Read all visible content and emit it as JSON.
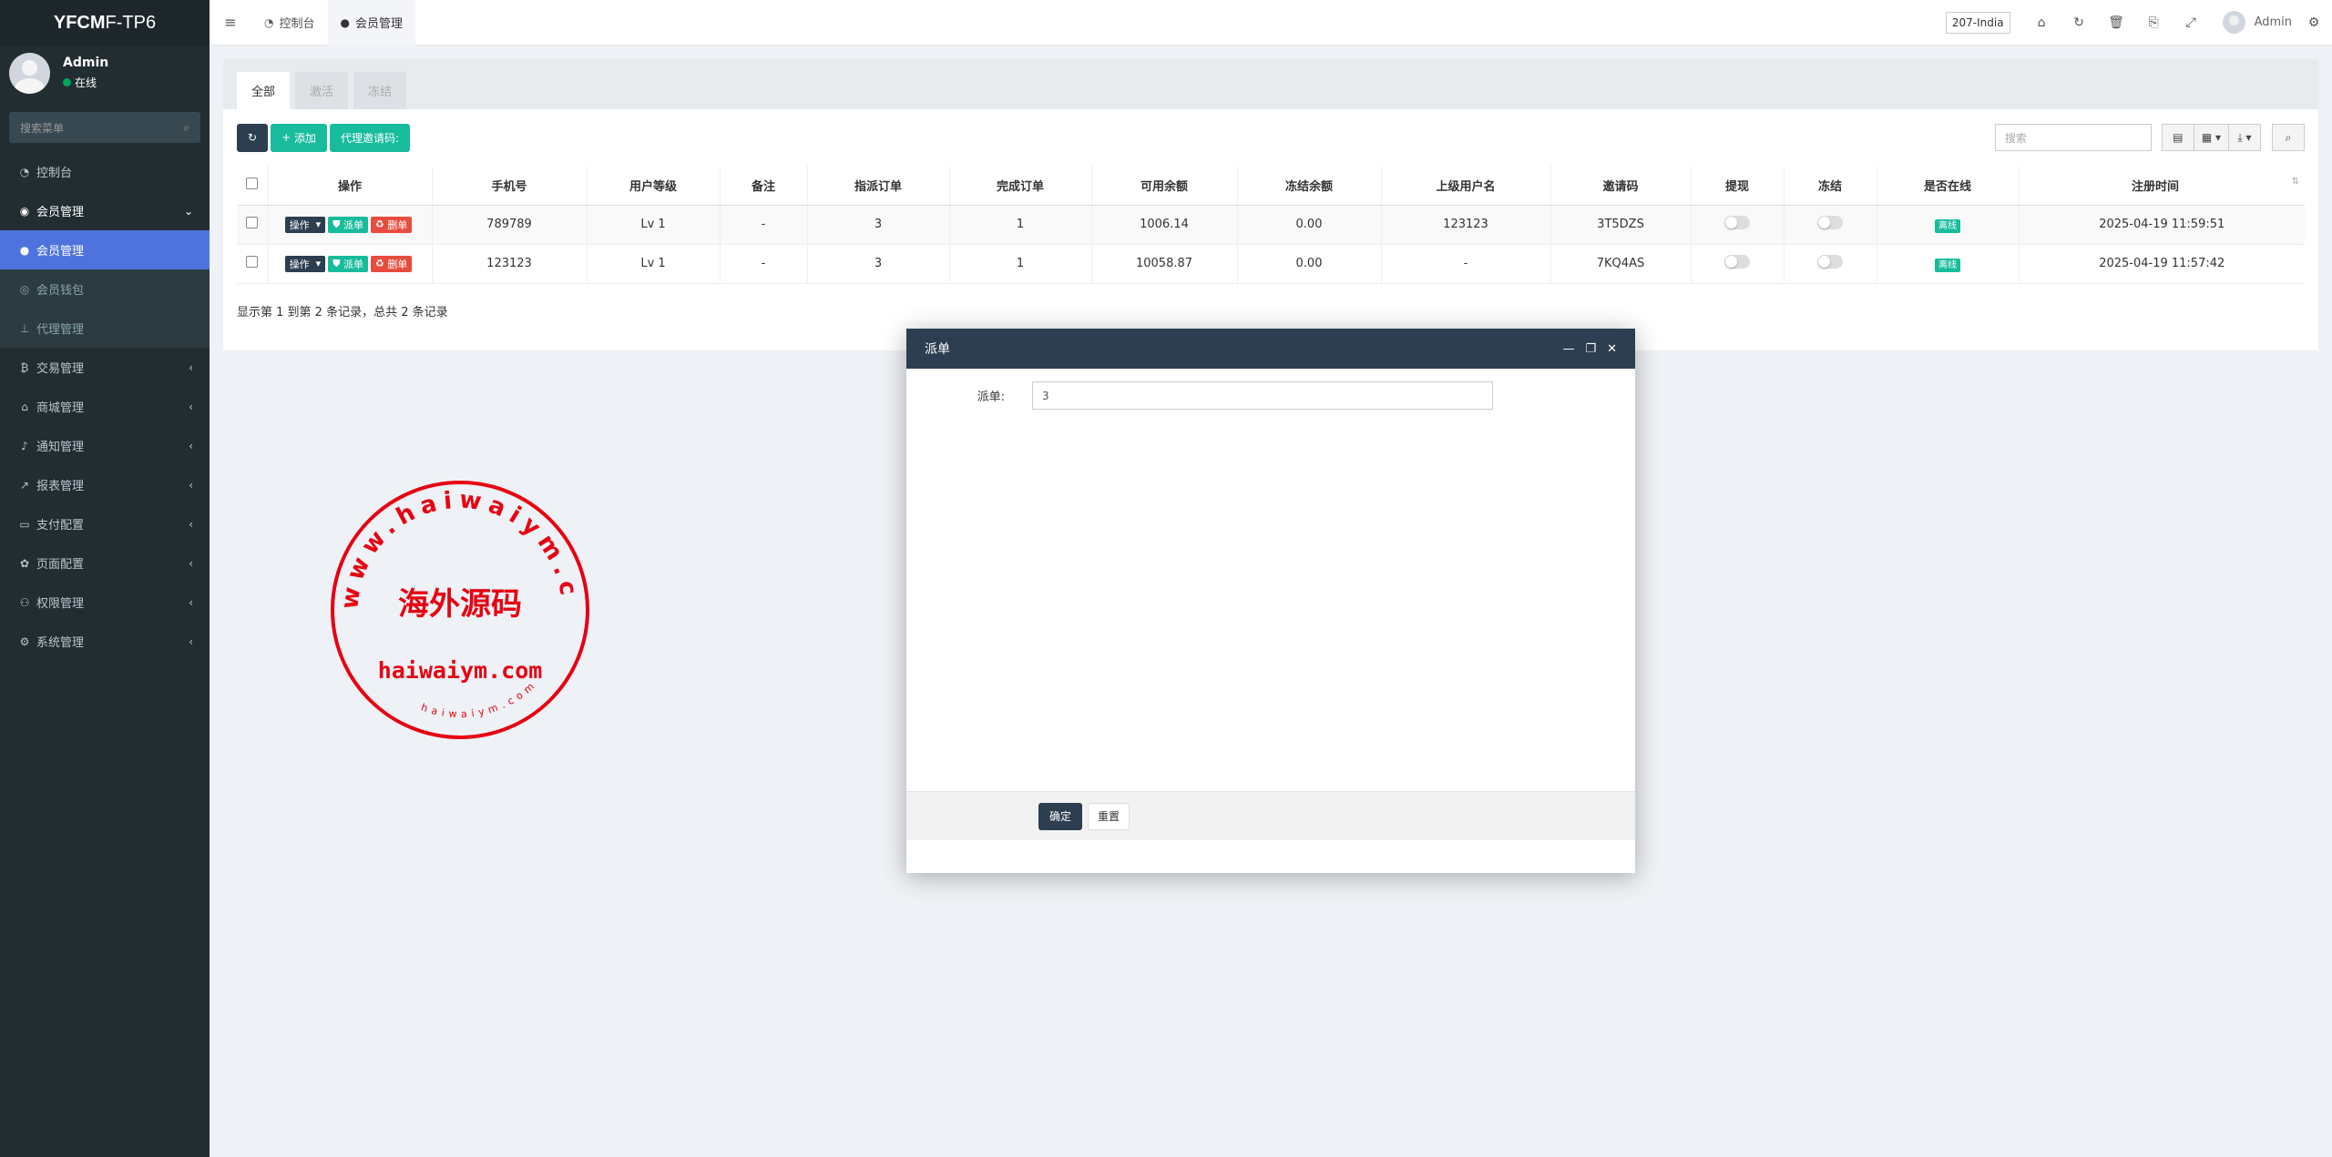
{
  "brand": {
    "bold": "YFCM",
    "rest": "F-TP6"
  },
  "user": {
    "name": "Admin",
    "status": "在线"
  },
  "search": {
    "placeholder": "搜索菜单"
  },
  "menu": {
    "dashboard": "控制台",
    "member": "会员管理",
    "member_sub": [
      "会员管理",
      "会员钱包",
      "代理管理"
    ],
    "items": [
      "交易管理",
      "商城管理",
      "通知管理",
      "报表管理",
      "支付配置",
      "页面配置",
      "权限管理",
      "系统管理"
    ]
  },
  "topbar": {
    "tabs": [
      "控制台",
      "会员管理"
    ],
    "lang": "207-India",
    "user": "Admin"
  },
  "content": {
    "tabs": [
      "全部",
      "激活",
      "冻结"
    ],
    "toolbar": {
      "add": "添加",
      "invite": "代理邀请码:",
      "search_placeholder": "搜索"
    },
    "columns": [
      "操作",
      "手机号",
      "用户等级",
      "备注",
      "指派订单",
      "完成订单",
      "可用余额",
      "冻结余额",
      "上级用户名",
      "邀请码",
      "提现",
      "冻结",
      "是否在线",
      "注册时间"
    ],
    "row_buttons": {
      "op": "操作",
      "assign": "派单",
      "delete": "删单"
    },
    "rows": [
      {
        "phone": "789789",
        "level": "Lv 1",
        "note": "-",
        "assigned": "3",
        "done": "1",
        "balance": "1006.14",
        "frozen": "0.00",
        "parent": "123123",
        "invite": "3T5DZS",
        "online": "离线",
        "reg": "2025-04-19 11:59:51"
      },
      {
        "phone": "123123",
        "level": "Lv 1",
        "note": "-",
        "assigned": "3",
        "done": "1",
        "balance": "10058.87",
        "frozen": "0.00",
        "parent": "-",
        "invite": "7KQ4AS",
        "online": "离线",
        "reg": "2025-04-19 11:57:42"
      }
    ],
    "pager": "显示第 1 到第 2 条记录，总共 2 条记录"
  },
  "stamp": {
    "ring_text": "www.haiwaiym.com",
    "center": "海外源码",
    "domain": "haiwaiym.com",
    "small": "haiwaiym.com"
  },
  "modal": {
    "title": "派单",
    "label": "派单:",
    "value": "3",
    "confirm": "确定",
    "reset": "重置"
  },
  "colors": {
    "sidebar": "#222d32",
    "accent": "#4e73df",
    "green": "#18bc9c",
    "red": "#e74c3c",
    "dark": "#2c3e50",
    "stamp": "#e60012"
  }
}
